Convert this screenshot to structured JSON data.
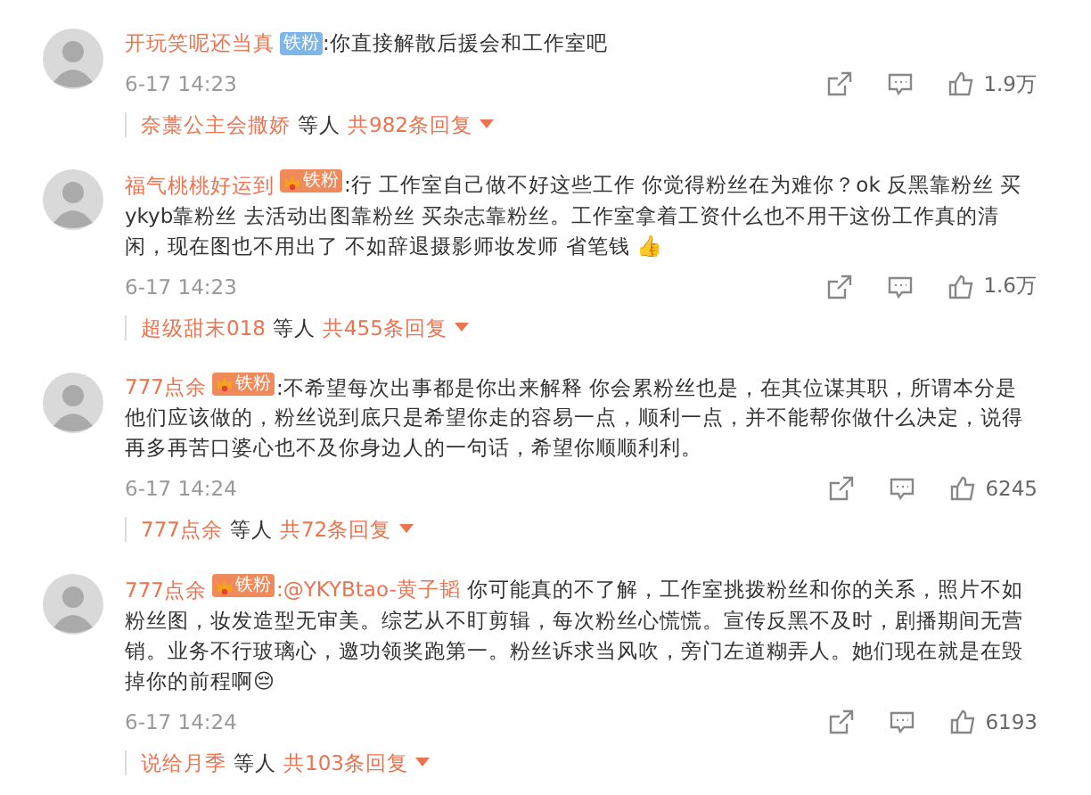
{
  "comments": [
    {
      "user": "开玩笑呢还当真",
      "badge": {
        "kind": "plain",
        "label": "铁粉"
      },
      "text": ":你直接解散后援会和工作室吧",
      "time": "6-17 14:23",
      "likes": "1.9万",
      "reply": {
        "name": "奈藁公主会撒娇",
        "mid": "等人",
        "count": "共982条回复"
      }
    },
    {
      "user": "福气桃桃好运到",
      "badge": {
        "kind": "crown",
        "label": "铁粉"
      },
      "text": ":行 工作室自己做不好这些工作 你觉得粉丝在为难你？ok 反黑靠粉丝 买ykyb靠粉丝 去活动出图靠粉丝 买杂志靠粉丝。工作室拿着工资什么也不用干这份工作真的清闲，现在图也不用出了 不如辞退摄影师妆发师 省笔钱 👍",
      "time": "6-17 14:23",
      "likes": "1.6万",
      "reply": {
        "name": "超级甜末018",
        "mid": "等人",
        "count": "共455条回复"
      }
    },
    {
      "user": "777点余",
      "badge": {
        "kind": "crown",
        "label": "铁粉"
      },
      "text": ":不希望每次出事都是你出来解释 你会累粉丝也是，在其位谋其职，所谓本分是他们应该做的，粉丝说到底只是希望你走的容易一点，顺利一点，并不能帮你做什么决定，说得再多再苦口婆心也不及你身边人的一句话，希望你顺顺利利。",
      "time": "6-17 14:24",
      "likes": "6245",
      "reply": {
        "name": "777点余",
        "mid": "等人",
        "count": "共72条回复"
      }
    },
    {
      "user": "777点余",
      "badge": {
        "kind": "crown",
        "label": "铁粉"
      },
      "mention": ":@YKYBtao-黄子韬",
      "text": " 你可能真的不了解，工作室挑拨粉丝和你的关系，照片不如粉丝图，妆发造型无审美。综艺从不盯剪辑，每次粉丝心慌慌。宣传反黑不及时，剧播期间无营销。业务不行玻璃心，邀功领奖跑第一。粉丝诉求当风吹，旁门左道糊弄人。她们现在就是在毁掉你的前程啊😔",
      "time": "6-17 14:24",
      "likes": "6193",
      "reply": {
        "name": "说给月季",
        "mid": "等人",
        "count": "共103条回复"
      }
    }
  ]
}
